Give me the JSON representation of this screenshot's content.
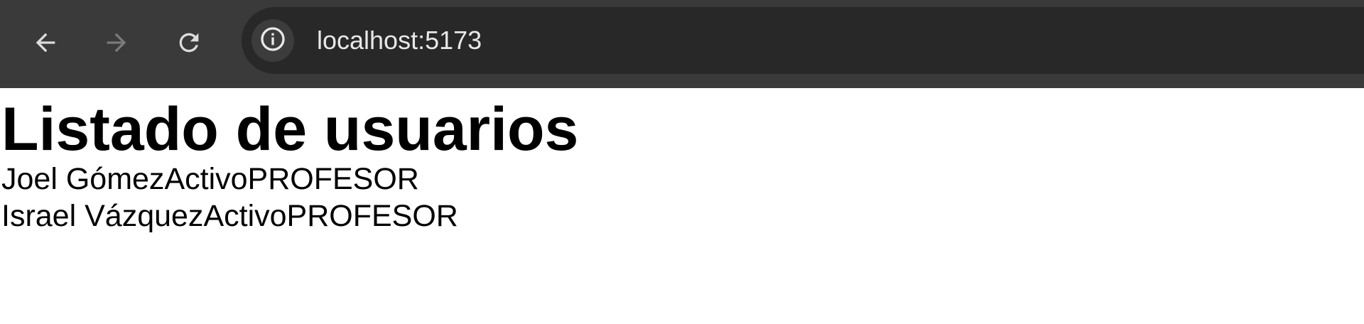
{
  "browser": {
    "url": "localhost:5173",
    "icons": {
      "back": "back-arrow-icon",
      "forward": "forward-arrow-icon",
      "reload": "reload-icon",
      "site_info": "info-icon"
    }
  },
  "page": {
    "title": "Listado de usuarios",
    "users": [
      {
        "name": "Joel Gómez",
        "status": "Activo",
        "role": "PROFESOR"
      },
      {
        "name": "Israel Vázquez",
        "status": "Activo",
        "role": "PROFESOR"
      }
    ]
  }
}
